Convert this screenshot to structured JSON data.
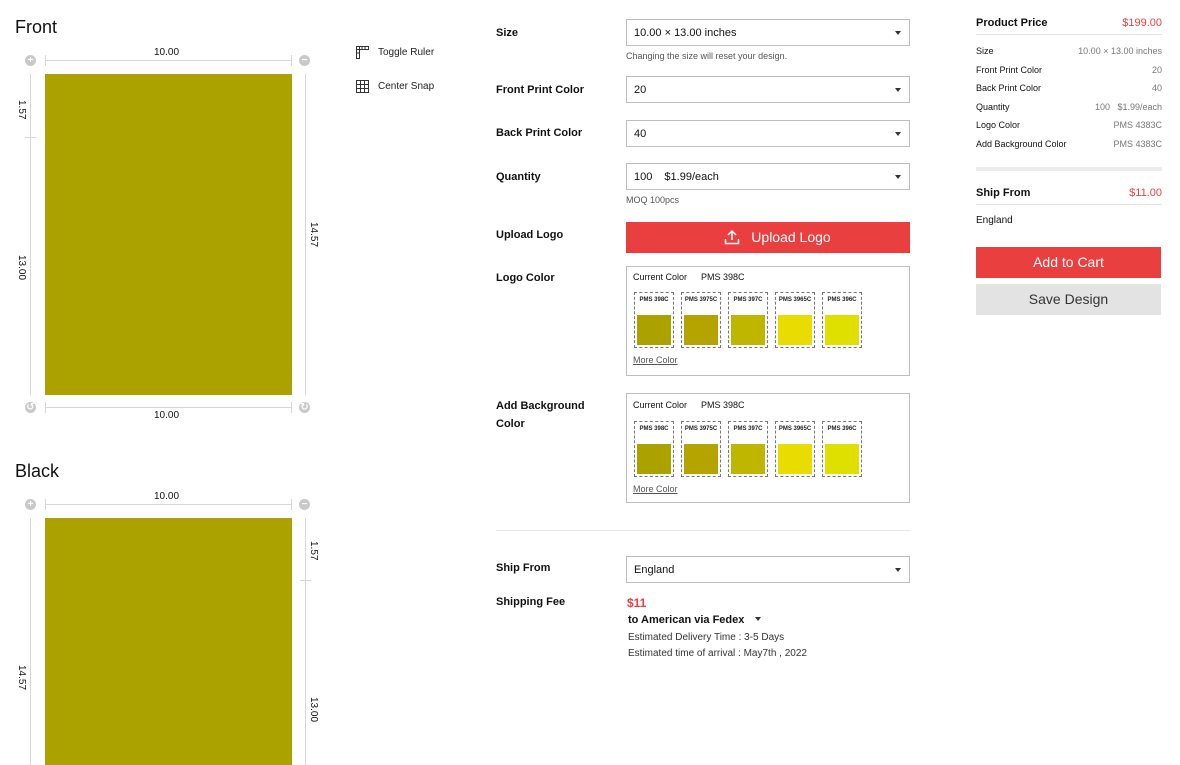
{
  "front": {
    "title": "Front",
    "top_width": "10.00",
    "bottom_width": "10.00",
    "left_top": "1.57",
    "left_main": "13.00",
    "right_height": "14.57",
    "print_color": "#aba200"
  },
  "back": {
    "title": "Black",
    "top_width": "10.00",
    "left_main": "14.57",
    "right_top": "1.57",
    "right_main": "13.00"
  },
  "tools": {
    "toggle_ruler": "Toggle Ruler",
    "center_snap": "Center Snap"
  },
  "form": {
    "size_label": "Size",
    "size_value": "10.00 × 13.00 inches",
    "size_hint": "Changing the size will reset your design.",
    "front_color_label": "Front Print Color",
    "front_color_value": "20",
    "back_color_label": "Back Print Color",
    "back_color_value": "40",
    "quantity_label": "Quantity",
    "quantity_value": "100",
    "quantity_price": "$1.99/each",
    "quantity_hint": "MOQ 100pcs",
    "upload_label": "Upload Logo",
    "upload_button": "Upload Logo",
    "logo_color_label": "Logo Color",
    "logo_current": "Current Color",
    "logo_current_value": "PMS 398C",
    "logo_more": "More Color",
    "bg_label_1": "Add Background",
    "bg_label_2": "Color",
    "bg_current": "Current Color",
    "bg_current_value": "PMS 398C",
    "bg_more": "More Color",
    "swatches": [
      {
        "name": "PMS 398C",
        "color": "#aba200"
      },
      {
        "name": "PMS 3975C",
        "color": "#b5a300"
      },
      {
        "name": "PMS 397C",
        "color": "#bfb600"
      },
      {
        "name": "PMS 3965C",
        "color": "#e8dc00"
      },
      {
        "name": "PMS 396C",
        "color": "#dfdf00"
      }
    ],
    "ship_from_label": "Ship From",
    "ship_from_value": "England",
    "shipping_fee_label": "Shipping Fee",
    "shipping_fee_value": "$11",
    "shipping_method": "to American via Fedex",
    "delivery_time": "Estimated Delivery Time : 3-5 Days",
    "arrival_time": "Estimated time of arrival : May7th , 2022"
  },
  "summary": {
    "product_price_label": "Product Price",
    "product_price_value": "$199.00",
    "rows": [
      {
        "k": "Size",
        "v": "10.00 × 13.00 inches"
      },
      {
        "k": "Front Print Color",
        "v": "20"
      },
      {
        "k": "Back Print Color",
        "v": "40"
      },
      {
        "k": "Quantity",
        "v": "100   $1.99/each"
      },
      {
        "k": "Logo Color",
        "v": "PMS 4383C"
      },
      {
        "k": "Add Background Color",
        "v": "PMS 4383C"
      }
    ],
    "ship_from_label": "Ship From",
    "ship_from_price": "$11.00",
    "ship_from_value": "England",
    "add_to_cart": "Add to Cart",
    "save_design": "Save Design",
    "accent_color": "#e9403f"
  }
}
